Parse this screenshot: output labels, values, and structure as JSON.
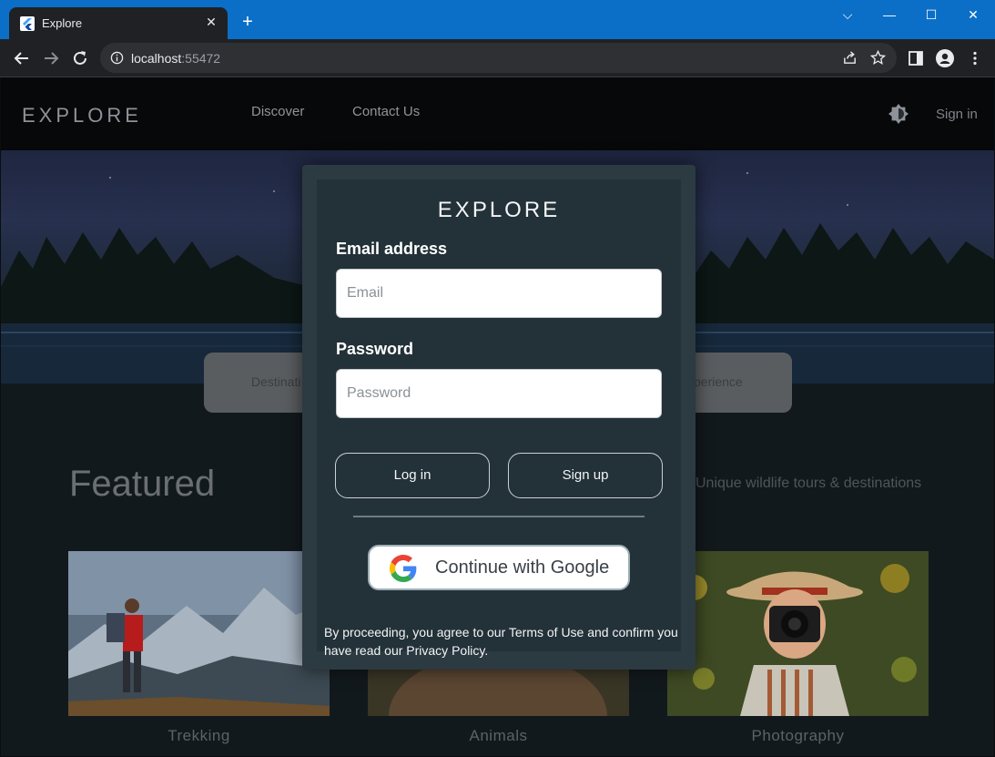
{
  "browser": {
    "tab_title": "Explore",
    "tab_close": "✕",
    "new_tab": "+",
    "url_host": "localhost",
    "url_port": ":55472",
    "window_controls": [
      "⌵",
      "—",
      "☐",
      "✕"
    ]
  },
  "site": {
    "brand": "EXPLORE",
    "nav": [
      "Discover",
      "Contact Us"
    ],
    "sign_in": "Sign in",
    "search_left": "Destinati",
    "search_right": "perience",
    "featured_title": "Featured",
    "tagline": "Unique wildlife tours & destinations",
    "cards": [
      "Trekking",
      "Animals",
      "Photography"
    ]
  },
  "modal": {
    "brand": "EXPLORE",
    "email_label": "Email address",
    "email_placeholder": "Email",
    "password_label": "Password",
    "password_placeholder": "Password",
    "login_label": "Log in",
    "signup_label": "Sign up",
    "google_label": "Continue with Google",
    "legal_text": "By proceeding, you agree to our Terms of Use and confirm you have read our Privacy Policy."
  },
  "colors": {
    "chrome_accent": "#0b6fc8",
    "modal_bg": "#233138",
    "google_blue": "#4285F4",
    "google_red": "#EA4335",
    "google_yellow": "#FBBC05",
    "google_green": "#34A853"
  }
}
